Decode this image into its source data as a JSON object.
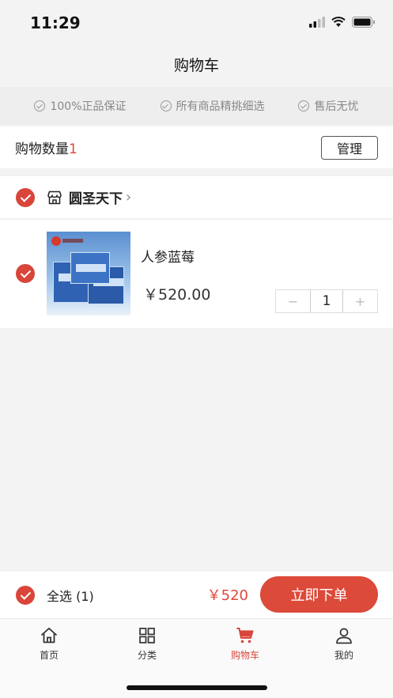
{
  "status_bar": {
    "time": "11:29"
  },
  "nav": {
    "title": "购物车"
  },
  "guarantees": [
    {
      "label": "100%正品保证"
    },
    {
      "label": "所有商品精挑细选"
    },
    {
      "label": "售后无忧"
    }
  ],
  "cart_summary": {
    "label": "购物数量",
    "count": "1",
    "manage_label": "管理"
  },
  "store": {
    "name": "圆圣天下",
    "chevron": "›"
  },
  "product": {
    "name": "人参蓝莓",
    "price": "￥520.00",
    "quantity": "1",
    "minus": "−",
    "plus": "+"
  },
  "checkout": {
    "select_all": "全选 (1)",
    "total": "￥520",
    "order_button": "立即下单"
  },
  "tabs": [
    {
      "label": "首页",
      "icon": "home-icon",
      "active": false
    },
    {
      "label": "分类",
      "icon": "grid-icon",
      "active": false
    },
    {
      "label": "购物车",
      "icon": "cart-icon",
      "active": true
    },
    {
      "label": "我的",
      "icon": "user-icon",
      "active": false
    }
  ],
  "colors": {
    "accent": "#d9453a",
    "price_red": "#e0463a",
    "background": "#f3f3f3"
  }
}
